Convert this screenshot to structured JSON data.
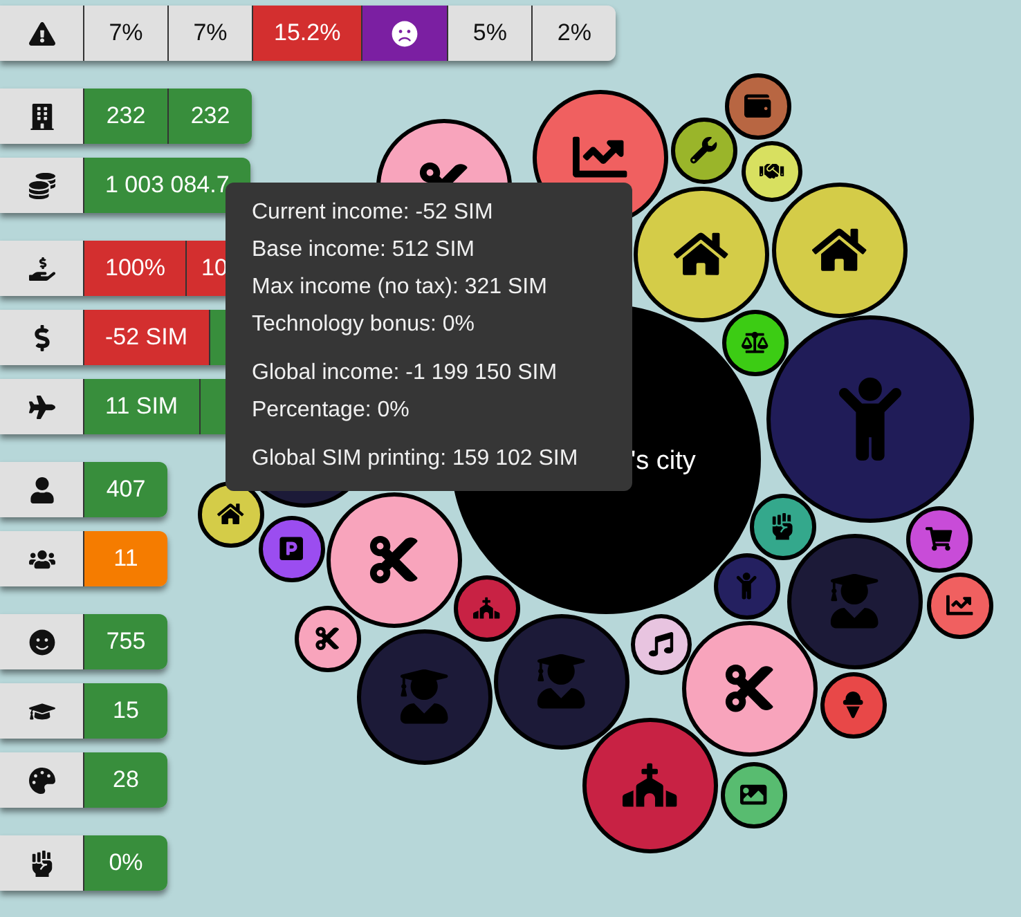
{
  "stat_groups": [
    [
      {
        "cells": [
          {
            "kind": "text",
            "text": "7%",
            "color": "#e0e0e0"
          },
          {
            "kind": "text",
            "text": "7%",
            "color": "#e0e0e0"
          },
          {
            "kind": "text",
            "text": "15.2%",
            "color": "#d32f2f"
          },
          {
            "kind": "icon",
            "color": "#7b1fa2"
          },
          {
            "kind": "text",
            "text": "5%",
            "color": "#e0e0e0"
          },
          {
            "kind": "text",
            "text": "2%",
            "color": "#e0e0e0"
          }
        ]
      }
    ],
    [
      {
        "cells": [
          {
            "kind": "text",
            "text": "232",
            "color": "#388e3c"
          },
          {
            "kind": "text",
            "text": "232",
            "color": "#388e3c"
          }
        ]
      },
      {
        "cells": [
          {
            "kind": "text",
            "text": "1 003 084.7",
            "color": "#388e3c"
          }
        ]
      }
    ],
    [
      {
        "cells": [
          {
            "kind": "text",
            "text": "100%",
            "color": "#d32f2f"
          },
          {
            "kind": "partial",
            "text": "10",
            "color": "#d32f2f"
          }
        ]
      },
      {
        "cells": [
          {
            "kind": "text",
            "text": "-52 SIM",
            "color": "#d32f2f"
          },
          {
            "kind": "blank",
            "color": "#388e3c"
          }
        ]
      },
      {
        "cells": [
          {
            "kind": "text",
            "text": "11 SIM",
            "color": "#388e3c"
          },
          {
            "kind": "blank",
            "color": "#388e3c"
          }
        ]
      }
    ],
    [
      {
        "cells": [
          {
            "kind": "text",
            "text": "407",
            "color": "#388e3c"
          }
        ]
      },
      {
        "cells": [
          {
            "kind": "text",
            "text": "11",
            "color": "#f57c00"
          }
        ]
      }
    ],
    [
      {
        "cells": [
          {
            "kind": "text",
            "text": "755",
            "color": "#388e3c"
          }
        ]
      },
      {
        "cells": [
          {
            "kind": "text",
            "text": "15",
            "color": "#388e3c"
          }
        ]
      },
      {
        "cells": [
          {
            "kind": "text",
            "text": "28",
            "color": "#388e3c"
          }
        ]
      }
    ],
    [
      {
        "cells": [
          {
            "kind": "text",
            "text": "0%",
            "color": "#388e3c"
          }
        ]
      }
    ]
  ],
  "city_label": "'s city",
  "tooltip": {
    "sections": [
      [
        "Current income: -52 SIM",
        "Base income: 512 SIM",
        "Max income (no tax): 321 SIM",
        "Technology bonus: 0%"
      ],
      [
        "Global income: -1 199 150 SIM",
        "Percentage: 0%"
      ],
      [
        "Global SIM printing: 159 102 SIM"
      ]
    ]
  }
}
